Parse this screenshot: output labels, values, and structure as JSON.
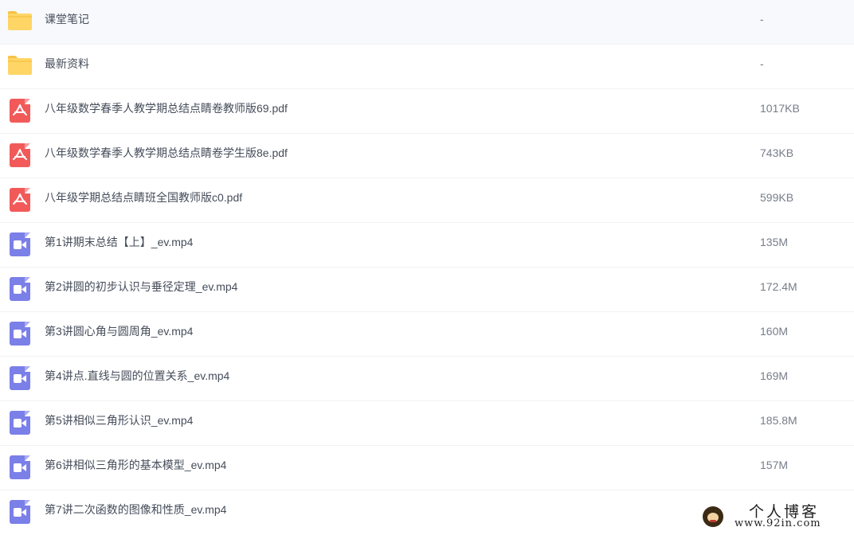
{
  "files": [
    {
      "type": "folder",
      "icon": "folder-icon",
      "name": "课堂笔记",
      "size": "-"
    },
    {
      "type": "folder",
      "icon": "folder-icon",
      "name": "最新资料",
      "size": "-"
    },
    {
      "type": "pdf",
      "icon": "pdf-icon",
      "name": "八年级数学春季人教学期总结点睛卷教师版69.pdf",
      "size": "1017KB"
    },
    {
      "type": "pdf",
      "icon": "pdf-icon",
      "name": "八年级数学春季人教学期总结点睛卷学生版8e.pdf",
      "size": "743KB"
    },
    {
      "type": "pdf",
      "icon": "pdf-icon",
      "name": "八年级学期总结点睛班全国教师版c0.pdf",
      "size": "599KB"
    },
    {
      "type": "video",
      "icon": "video-icon",
      "name": "第1讲期末总结【上】_ev.mp4",
      "size": "135M"
    },
    {
      "type": "video",
      "icon": "video-icon",
      "name": "第2讲圆的初步认识与垂径定理_ev.mp4",
      "size": "172.4M"
    },
    {
      "type": "video",
      "icon": "video-icon",
      "name": "第3讲圆心角与圆周角_ev.mp4",
      "size": "160M"
    },
    {
      "type": "video",
      "icon": "video-icon",
      "name": "第4讲点.直线与圆的位置关系_ev.mp4",
      "size": "169M"
    },
    {
      "type": "video",
      "icon": "video-icon",
      "name": "第5讲相似三角形认识_ev.mp4",
      "size": "185.8M"
    },
    {
      "type": "video",
      "icon": "video-icon",
      "name": "第6讲相似三角形的基本模型_ev.mp4",
      "size": "157M"
    },
    {
      "type": "video",
      "icon": "video-icon",
      "name": "第7讲二次函数的图像和性质_ev.mp4",
      "size": ""
    }
  ],
  "watermark": {
    "title": "个人博客",
    "url": "www.92in.com"
  },
  "colors": {
    "folder": "#ffd566",
    "pdf": "#f25a5a",
    "video": "#7b7fe8",
    "row_divider": "#f1f2f4"
  }
}
